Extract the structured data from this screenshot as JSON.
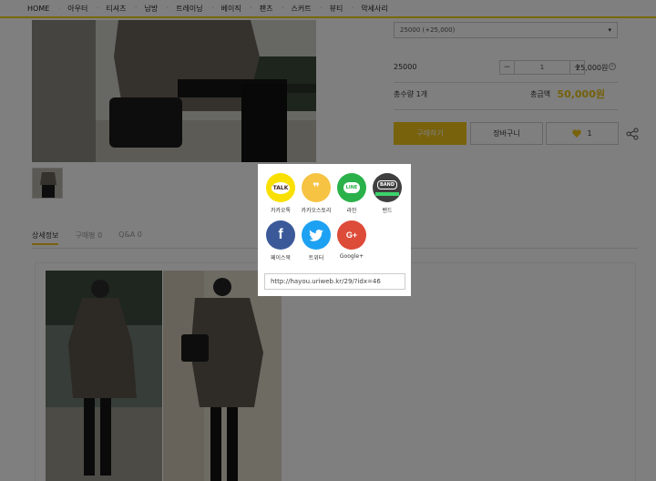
{
  "nav": {
    "items": [
      "HOME",
      "아우터",
      "티셔츠",
      "남방",
      "트레이닝",
      "베이직",
      "팬츠",
      "스커트",
      "뷰티",
      "악세사리"
    ]
  },
  "product": {
    "option_select": "25000 (+25,000)",
    "option_row": {
      "label": "25000",
      "quantity": "1",
      "price": "25,000원",
      "minus": "−",
      "plus": "+"
    },
    "total_qty_label": "총수량 1개",
    "total_label": "총금액",
    "total_amount": "50,000원",
    "buy_label": "구매하기",
    "cart_label": "장바구니",
    "wish_count": "1"
  },
  "tabs": [
    {
      "label": "상세정보"
    },
    {
      "label": "구매평 0"
    },
    {
      "label": "Q&A 0"
    }
  ],
  "share_popup": {
    "items": [
      {
        "label": "카카오톡",
        "icon_text": "TALK",
        "color": "#f9e000"
      },
      {
        "label": "카카오스토리",
        "icon_text": "❞",
        "color": "#f6c343"
      },
      {
        "label": "라인",
        "icon_text": "LINE",
        "color": "#2bb14a"
      },
      {
        "label": "밴드",
        "icon_text": "BAND",
        "color": "#3f3f3f"
      },
      {
        "label": "페이스북",
        "icon_text": "f",
        "color": "#3b5998"
      },
      {
        "label": "트위터",
        "icon_text": "🐦",
        "color": "#1da1f2"
      },
      {
        "label": "Google+",
        "icon_text": "G+",
        "color": "#dd4b39"
      }
    ],
    "url": "http://hayou.uriweb.kr/29/?idx=46"
  },
  "colors": {
    "accent": "#f0c419",
    "nav_border": "#f0d010"
  }
}
